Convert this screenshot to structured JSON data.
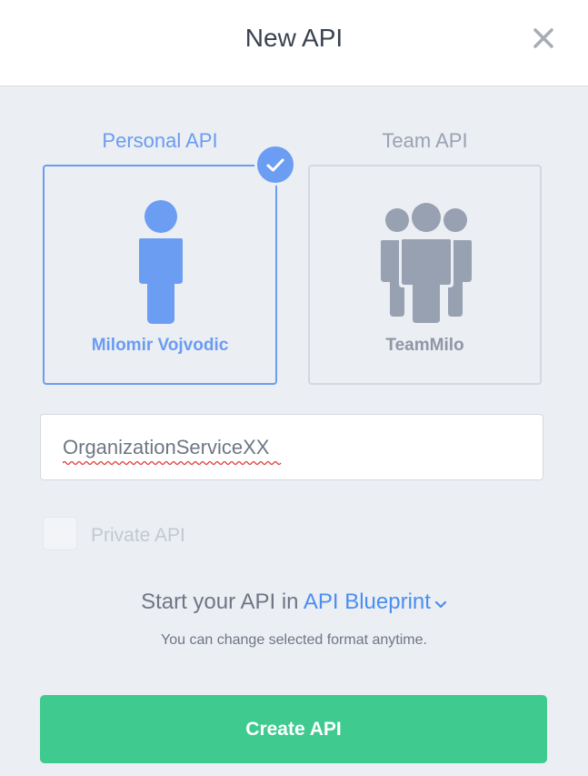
{
  "dialog": {
    "title": "New API",
    "close_icon": "close-icon"
  },
  "types": {
    "personal": {
      "label": "Personal API",
      "name": "Milomir Vojvodic",
      "icon": "person-icon",
      "selected": true
    },
    "team": {
      "label": "Team API",
      "name": "TeamMilo",
      "icon": "team-icon",
      "selected": false
    }
  },
  "api_name": {
    "value": "OrganizationServiceXX"
  },
  "private": {
    "label": "Private API",
    "checked": false
  },
  "format": {
    "prefix": "Start your API in ",
    "selected": "API Blueprint",
    "hint": "You can change selected format anytime."
  },
  "actions": {
    "create_label": "Create API"
  },
  "colors": {
    "accent": "#6b9df2",
    "link": "#4a8ef0",
    "create": "#3fca8f",
    "inactive": "#9aa3b2"
  }
}
